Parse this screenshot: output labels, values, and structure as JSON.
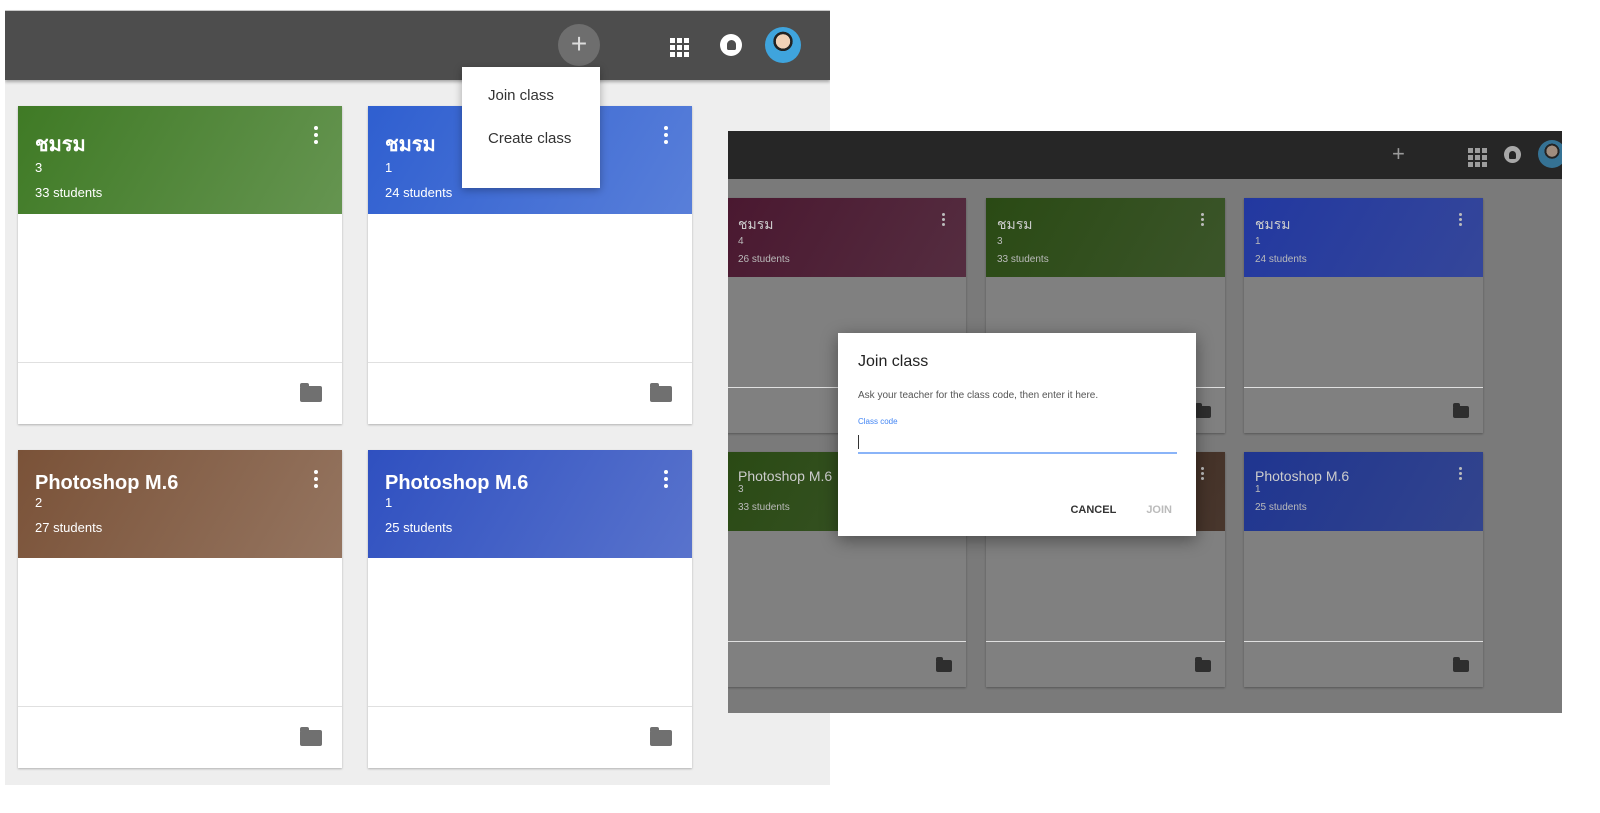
{
  "left_screen": {
    "header": {
      "add_icon": "plus-icon",
      "apps_icon": "apps-grid-icon",
      "notifications_icon": "bell-icon",
      "avatar": "user-avatar"
    },
    "add_menu": {
      "items": [
        "Join class",
        "Create class"
      ]
    },
    "classes": [
      {
        "title": "ชมรม",
        "section": "3",
        "students": "33 students",
        "color": "#3f7a25"
      },
      {
        "title": "ชมรม",
        "section": "1",
        "students": "24 students",
        "color": "#2f5fd0"
      },
      {
        "title": "Photoshop M.6",
        "section": "2",
        "students": "27 students",
        "color": "#7a5238"
      },
      {
        "title": "Photoshop M.6",
        "section": "1",
        "students": "25 students",
        "color": "#2f50c0"
      }
    ]
  },
  "right_screen": {
    "classes": [
      {
        "title": "ชมรม",
        "section": "4",
        "students": "26 students",
        "color": "#4a1830"
      },
      {
        "title": "ชมรม",
        "section": "3",
        "students": "33 students",
        "color": "#2a4a14"
      },
      {
        "title": "ชมรม",
        "section": "1",
        "students": "24 students",
        "color": "#2238a0"
      },
      {
        "title": "Photoshop M.6",
        "section": "3",
        "students": "33 students",
        "color": "#2a4a14"
      },
      {
        "title": "",
        "section": "",
        "students": "",
        "color": "#3a2418"
      },
      {
        "title": "Photoshop M.6",
        "section": "1",
        "students": "25 students",
        "color": "#1f3590"
      }
    ],
    "dialog": {
      "title": "Join class",
      "description": "Ask your teacher for the class code, then enter it here.",
      "field_label": "Class code",
      "field_value": "",
      "cancel": "CANCEL",
      "join": "JOIN"
    }
  }
}
